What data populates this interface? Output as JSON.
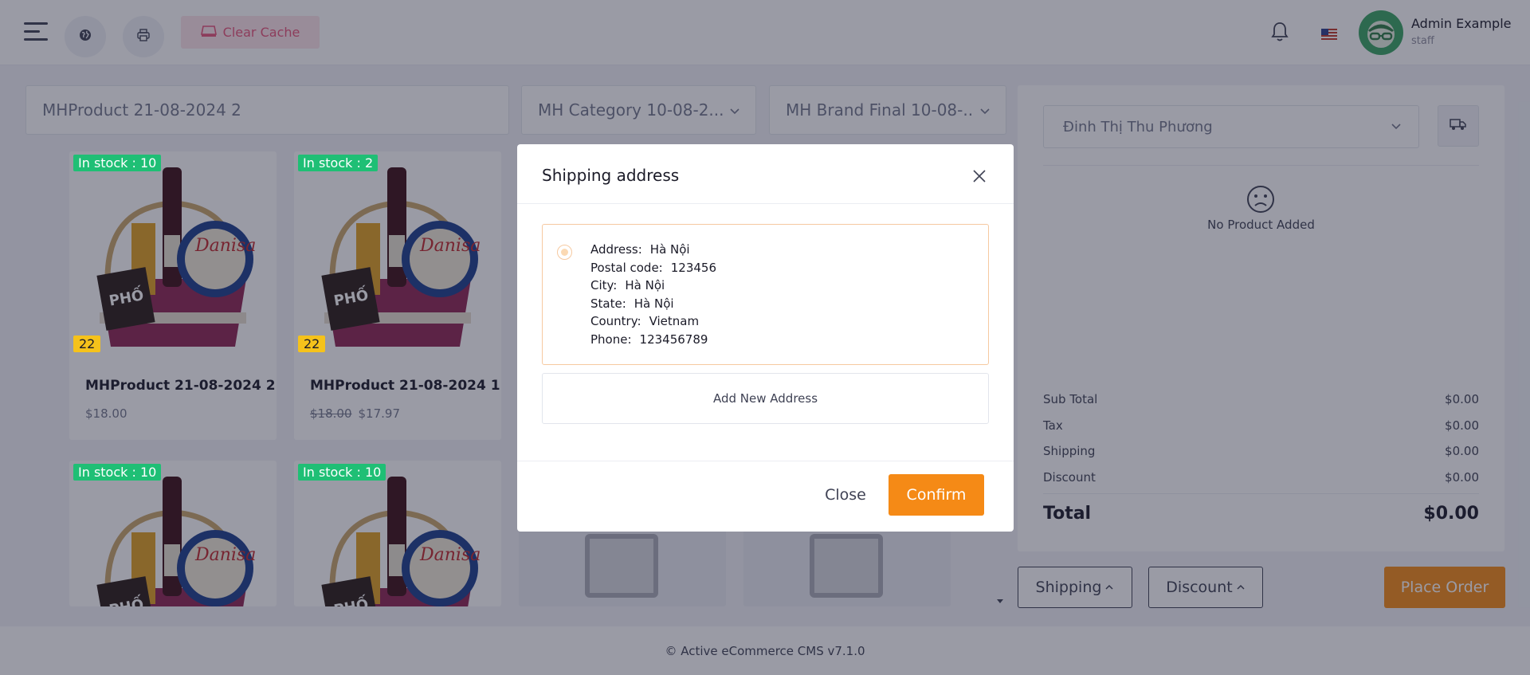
{
  "header": {
    "clear_cache_label": "Clear Cache",
    "user_name": "Admin Example",
    "user_role": "staff"
  },
  "filters": {
    "search_value": "MHProduct 21-08-2024 2",
    "category_value": "MH Category 10-08-2...",
    "brand_value": "MH Brand Final 10-08-..."
  },
  "products": [
    {
      "stock_label": "In stock : 10",
      "badge": "22",
      "name": "MHProduct 21-08-2024 2",
      "old_price": "",
      "price": "$18.00"
    },
    {
      "stock_label": "In stock : 2",
      "badge": "22",
      "name": "MHProduct 21-08-2024 1",
      "old_price": "$18.00",
      "price": "$17.97"
    },
    {
      "stock_label": "In stock : 10"
    },
    {
      "stock_label": "In stock : 10"
    }
  ],
  "cart": {
    "customer_value": "Đinh Thị Thu Phương",
    "empty_text": "No Product Added",
    "summary": [
      {
        "label": "Sub Total",
        "value": "$0.00"
      },
      {
        "label": "Tax",
        "value": "$0.00"
      },
      {
        "label": "Shipping",
        "value": "$0.00"
      },
      {
        "label": "Discount",
        "value": "$0.00"
      }
    ],
    "total_label": "Total",
    "total_value": "$0.00"
  },
  "actions": {
    "shipping_label": "Shipping",
    "discount_label": "Discount",
    "place_order_label": "Place Order"
  },
  "footer": {
    "text": "© Active eCommerce CMS v7.1.0"
  },
  "modal": {
    "title": "Shipping address",
    "address": [
      {
        "label": "Address:",
        "value": "Hà Nội"
      },
      {
        "label": "Postal code:",
        "value": "123456"
      },
      {
        "label": "City:",
        "value": "Hà Nội"
      },
      {
        "label": "State:",
        "value": "Hà Nội"
      },
      {
        "label": "Country:",
        "value": "Vietnam"
      },
      {
        "label": "Phone:",
        "value": "123456789"
      }
    ],
    "add_new_label": "Add New Address",
    "close_label": "Close",
    "confirm_label": "Confirm"
  },
  "colors": {
    "accent": "#f58a16",
    "stock_badge": "#1fbf75",
    "count_badge": "#f5c21b",
    "clear_cache_text": "#e8557a"
  },
  "icons": [
    "menu-icon",
    "globe-icon",
    "printer-icon",
    "cache-icon",
    "bell-icon",
    "us-flag-icon",
    "truck-icon",
    "sad-face-icon",
    "close-icon",
    "chevron-down-icon",
    "chevron-up-icon",
    "image-placeholder-icon"
  ]
}
